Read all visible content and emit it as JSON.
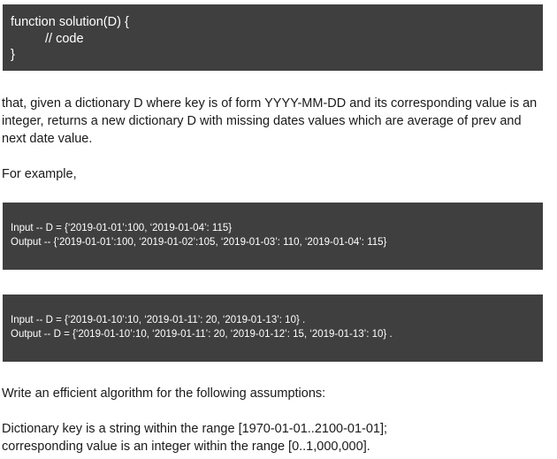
{
  "signature": {
    "line1": "function solution(D) {",
    "line2": "// code",
    "line3": "}"
  },
  "description": {
    "line1": "that, given a dictionary D where key is of form YYYY-MM-DD and its corresponding value is an",
    "line2": "integer, returns a new dictionary D with missing dates values which are average of prev and",
    "line3": "next date value."
  },
  "example_intro": "For example,",
  "examples": [
    {
      "input": "Input -- D = {‘2019-01-01’:100, ‘2019-01-04’: 115}",
      "output": "Output -- {‘2019-01-01’:100, ‘2019-01-02’:105, ‘2019-01-03’: 110, ‘2019-01-04’: 115}"
    },
    {
      "input": "Input -- D = {‘2019-01-10’:10, ‘2019-01-11’: 20, ‘2019-01-13’: 10} .",
      "output": "Output -- D = {‘2019-01-10’:10, ‘2019-01-11’: 20, ‘2019-01-12’: 15, ‘2019-01-13’: 10} ."
    }
  ],
  "write_prompt": "Write an efficient algorithm for the following assumptions:",
  "assumptions": {
    "line1": "Dictionary key is a string within the range [1970-01-01..2100-01-01];",
    "line2": "corresponding value is an integer within the range [0..1,000,000]."
  }
}
